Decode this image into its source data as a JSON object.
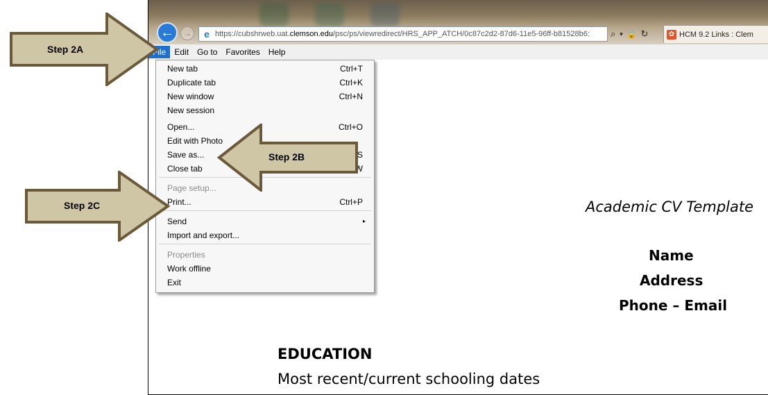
{
  "browser": {
    "url_prefix": "https://cubshrweb.uat.",
    "url_host": "clemson.edu",
    "url_path": "/psc/ps/viewredirect/HRS_APP_ATCH/0c87c2d2-87d6-11e5-96ff-b81528b6:",
    "tab_title": "HCM 9.2 Links : Clem",
    "tab_icon": "clemson-paw-icon",
    "addr_search_glyph": "⌕",
    "addr_dropdown_glyph": "▾",
    "addr_lock_glyph": "🔒",
    "addr_refresh_glyph": "↻"
  },
  "menubar": {
    "items": [
      "File",
      "Edit",
      "Go to",
      "Favorites",
      "Help"
    ]
  },
  "file_menu": {
    "items": [
      {
        "label": "New tab",
        "shortcut": "Ctrl+T"
      },
      {
        "label": "Duplicate tab",
        "shortcut": "Ctrl+K"
      },
      {
        "label": "New window",
        "shortcut": "Ctrl+N"
      },
      {
        "label": "New session",
        "shortcut": ""
      },
      {
        "label": "Open...",
        "shortcut": "Ctrl+O"
      },
      {
        "label": "Edit with Photo",
        "shortcut": ""
      },
      {
        "label": "Save as...",
        "shortcut": "S"
      },
      {
        "label": "Close tab",
        "shortcut": "W"
      },
      {
        "label": "Page setup...",
        "shortcut": ""
      },
      {
        "label": "Print...",
        "shortcut": "Ctrl+P"
      },
      {
        "label": "Send",
        "shortcut": ""
      },
      {
        "label": "Import and export...",
        "shortcut": ""
      },
      {
        "label": "Properties",
        "shortcut": ""
      },
      {
        "label": "Work offline",
        "shortcut": ""
      },
      {
        "label": "Exit",
        "shortcut": ""
      }
    ]
  },
  "document": {
    "title": "Academic CV Template",
    "name": "Name",
    "address": "Address",
    "contact": "Phone – Email",
    "section_heading": "EDUCATION",
    "section_line": "Most recent/current schooling   dates"
  },
  "callouts": {
    "step_2a": "Step 2A",
    "step_2b": "Step 2B",
    "step_2c": "Step 2C",
    "fill_color": "#cfc6a6",
    "stroke_color": "#6b5a3a"
  }
}
